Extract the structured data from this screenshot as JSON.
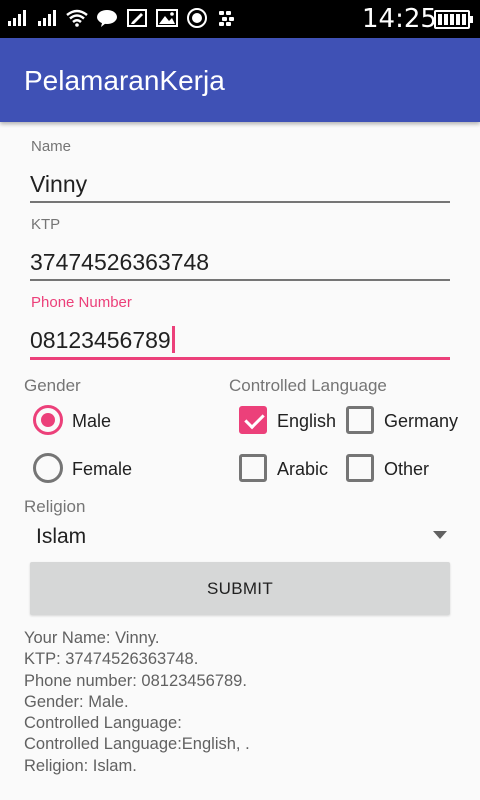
{
  "status_bar": {
    "icons": [
      "signal-bars-1-icon",
      "signal-bars-2-icon",
      "wifi-icon",
      "line-app-icon",
      "edit-icon",
      "gallery-icon",
      "app-notification-icon",
      "bbm-icon"
    ],
    "time": "14:25"
  },
  "app_bar": {
    "title": "PelamaranKerja"
  },
  "form": {
    "name": {
      "label": "Name",
      "value": "Vinny"
    },
    "ktp": {
      "label": "KTP",
      "value": "37474526363748"
    },
    "phone": {
      "label": "Phone Number",
      "value": "08123456789"
    },
    "gender": {
      "label": "Gender",
      "options": [
        {
          "label": "Male",
          "checked": true
        },
        {
          "label": "Female",
          "checked": false
        }
      ]
    },
    "language": {
      "label": "Controlled Language",
      "options": [
        {
          "label": "English",
          "checked": true
        },
        {
          "label": "Germany",
          "checked": false
        },
        {
          "label": "Arabic",
          "checked": false
        },
        {
          "label": "Other",
          "checked": false
        }
      ]
    },
    "religion": {
      "label": "Religion",
      "selected": "Islam"
    },
    "submit_label": "SUBMIT"
  },
  "result": {
    "lines": [
      "Your Name: Vinny.",
      "KTP: 37474526363748.",
      "Phone number: 08123456789.",
      "Gender: Male.",
      "Controlled Language:",
      "Controlled Language:English, .",
      "Religion: Islam."
    ]
  },
  "colors": {
    "app_bar": "#3f51b5",
    "accent": "#ec407a",
    "status_bar": "#000000"
  }
}
